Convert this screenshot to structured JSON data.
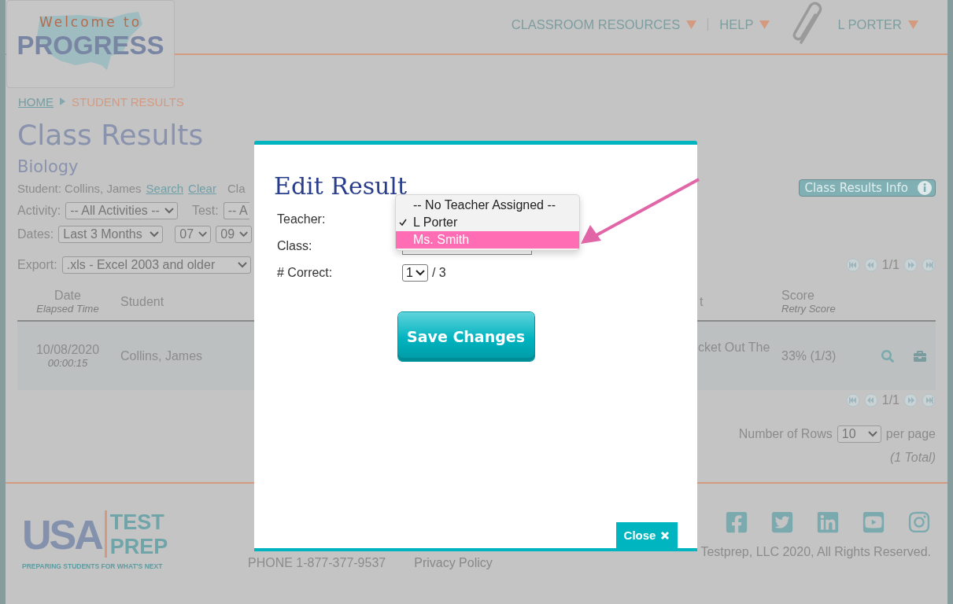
{
  "header": {
    "logo": {
      "line_1": "Welcome to",
      "line_2": "PROGRESS"
    },
    "nav": [
      {
        "label": "CLASSROOM RESOURCES",
        "kind": "menu"
      },
      {
        "label": "HELP",
        "kind": "menu"
      },
      {
        "label": "L PORTER",
        "kind": "user"
      }
    ]
  },
  "breadcrumb": [
    {
      "label": "HOME",
      "kind": "link"
    },
    {
      "label": "STUDENT RESULTS",
      "kind": "current"
    }
  ],
  "page_title": "Class Results",
  "class_name": "Biology",
  "student_filter": {
    "label": "Student: Collins, James",
    "links": [
      "Search",
      "Clear"
    ],
    "column_2": "Cla"
  },
  "info_button": "Class Results Info",
  "filters": {
    "activity": {
      "label": "Activity:",
      "value": "-- All Activities --"
    },
    "test": {
      "label": "Test:",
      "value": "-- A"
    },
    "dates": {
      "label": "Dates:",
      "range": "Last 3 Months",
      "selects": [
        "07",
        "09"
      ]
    }
  },
  "export": {
    "label": "Export:",
    "value": ".xls - Excel 2003 and older"
  },
  "pagination_top": "1/1",
  "table": {
    "columns": [
      {
        "title": "Date",
        "subtitle": "Elapsed Time"
      },
      {
        "title": "Student"
      },
      {
        "title": "t"
      },
      {
        "title": "Score",
        "subtitle": "Retry Score"
      }
    ],
    "rows": [
      {
        "date": "10/08/2020",
        "elapsed": "00:00:15",
        "student": "Collins, James",
        "column_3": "cket Out The",
        "score": "33% (1/3)"
      }
    ]
  },
  "pagination_bottom": "1/1",
  "rows_per_page": {
    "label": "Number of Rows",
    "value": "10",
    "suffix": "per page"
  },
  "total": "(1 Total)",
  "footer": {
    "logo": {
      "usa": "USA",
      "test": "TEST",
      "prep": "PREP",
      "tagline": "PREPARING STUDENTS FOR WHAT'S NEXT"
    },
    "phone": "PHONE 1-877-377-9537",
    "privacy": "Privacy Policy",
    "copyright": "Testprep, LLC 2020, All Rights Reserved."
  },
  "dialog": {
    "title": "Edit Result",
    "fields": [
      {
        "label": "Teacher:",
        "kind": "teacher"
      },
      {
        "label": "Class:",
        "kind": "class"
      },
      {
        "label": "# Correct:",
        "kind": "correct",
        "value": "1",
        "total": "/ 3"
      }
    ],
    "teacher_options": [
      {
        "label": "-- No Teacher Assigned --",
        "selected": false,
        "highlighted": false
      },
      {
        "label": "L Porter",
        "selected": true,
        "highlighted": false
      },
      {
        "label": "Ms. Smith",
        "selected": false,
        "highlighted": true
      }
    ],
    "save_button": "Save Changes",
    "close_button": "Close"
  }
}
